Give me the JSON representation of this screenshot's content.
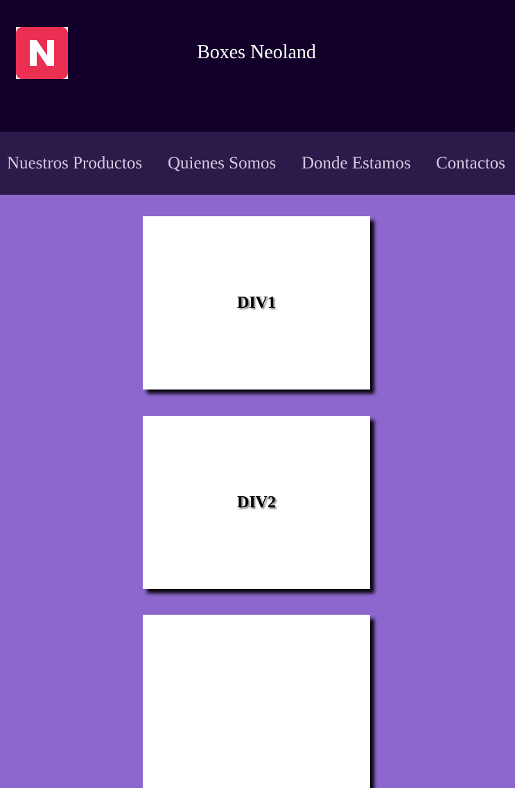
{
  "header": {
    "logo_letter": "N",
    "logo_color": "#ea2f52",
    "title": "Boxes Neoland",
    "background": "#12002a"
  },
  "nav": {
    "background": "#2c1a4a",
    "items": [
      {
        "label": "Nuestros Productos"
      },
      {
        "label": "Quienes Somos"
      },
      {
        "label": "Donde Estamos"
      },
      {
        "label": "Contactos"
      }
    ]
  },
  "main": {
    "background": "#8e67ce",
    "boxes": [
      {
        "label": "DIV1"
      },
      {
        "label": "DIV2"
      },
      {
        "label": ""
      }
    ]
  }
}
